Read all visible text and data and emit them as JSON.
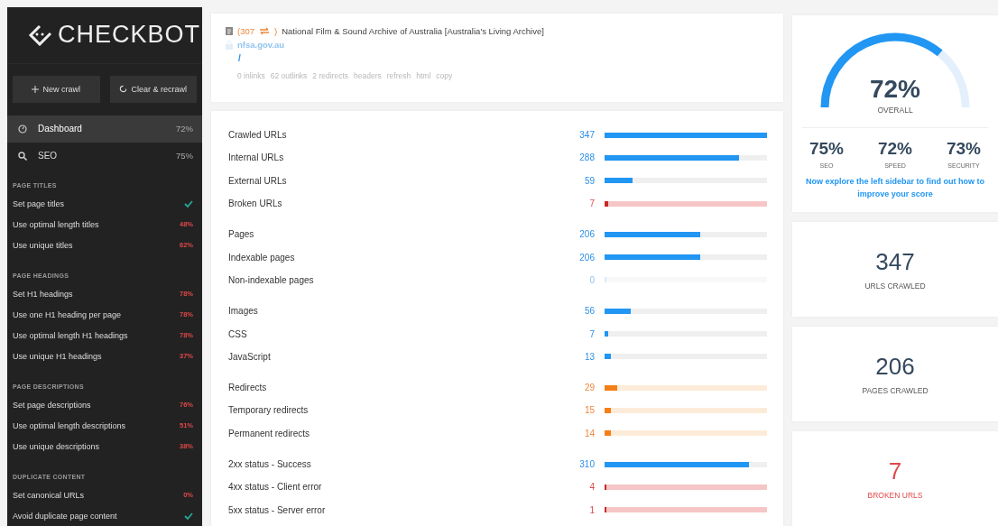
{
  "sidebar": {
    "logo": "CHECKBOT",
    "buttons": [
      {
        "kind": "new",
        "label": "New crawl"
      },
      {
        "kind": "recrawl",
        "label": "Clear & recrawl"
      }
    ],
    "nav": [
      {
        "kind": "dashboard",
        "label": "Dashboard",
        "value": "72%",
        "selected": true
      },
      {
        "kind": "search",
        "label": "SEO",
        "value": "75%",
        "selected": false
      }
    ],
    "sections": [
      {
        "title": "PAGE TITLES",
        "items": [
          {
            "label": "Set page titles",
            "kind": "check"
          },
          {
            "label": "Use optimal length titles",
            "kind": "percent",
            "value": "48%"
          },
          {
            "label": "Use unique titles",
            "kind": "percent",
            "value": "62%"
          }
        ]
      },
      {
        "title": "PAGE HEADINGS",
        "items": [
          {
            "label": "Set H1 headings",
            "kind": "percent",
            "value": "78%"
          },
          {
            "label": "Use one H1 heading per page",
            "kind": "percent",
            "value": "78%"
          },
          {
            "label": "Use optimal length H1 headings",
            "kind": "percent",
            "value": "78%"
          },
          {
            "label": "Use unique H1 headings",
            "kind": "percent",
            "value": "37%"
          }
        ]
      },
      {
        "title": "PAGE DESCRIPTIONS",
        "items": [
          {
            "label": "Set page descriptions",
            "kind": "percent",
            "value": "76%"
          },
          {
            "label": "Use optimal length descriptions",
            "kind": "percent",
            "value": "51%"
          },
          {
            "label": "Use unique descriptions",
            "kind": "percent",
            "value": "38%"
          }
        ]
      },
      {
        "title": "DUPLICATE CONTENT",
        "items": [
          {
            "label": "Set canonical URLs",
            "kind": "percent",
            "value": "0%"
          },
          {
            "label": "Avoid duplicate page content",
            "kind": "check"
          }
        ]
      }
    ]
  },
  "page_card": {
    "status_open": "(307",
    "status_close": ")",
    "title": "National Film & Sound Archive of Australia [Australia's Living Archive]",
    "domain": "nfsa.gov.au",
    "path": "/",
    "links": [
      "0 inlinks",
      "62 outlinks",
      "2 redirects",
      "headers",
      "refresh",
      "html",
      "copy"
    ]
  },
  "stats": [
    {
      "rows": [
        {
          "label": "Crawled URLs",
          "value": "347",
          "kind": "normal",
          "level": 1.0
        },
        {
          "label": "Internal URLs",
          "value": "288",
          "kind": "normal",
          "level": 0.83
        },
        {
          "label": "External URLs",
          "value": "59",
          "kind": "normal",
          "level": 0.17
        },
        {
          "label": "Broken URLs",
          "value": "7",
          "kind": "error",
          "level": 0.02
        }
      ]
    },
    {
      "rows": [
        {
          "label": "Pages",
          "value": "206",
          "kind": "normal",
          "level": 0.59
        },
        {
          "label": "Indexable pages",
          "value": "206",
          "kind": "normal",
          "level": 0.59
        },
        {
          "label": "Non-indexable pages",
          "value": "0",
          "kind": "empty",
          "level": 0
        }
      ]
    },
    {
      "rows": [
        {
          "label": "Images",
          "value": "56",
          "kind": "normal",
          "level": 0.16
        },
        {
          "label": "CSS",
          "value": "7",
          "kind": "normal",
          "level": 0.02
        },
        {
          "label": "JavaScript",
          "value": "13",
          "kind": "normal",
          "level": 0.04
        }
      ]
    },
    {
      "rows": [
        {
          "label": "Redirects",
          "value": "29",
          "kind": "warning",
          "level": 0.08
        },
        {
          "label": "Temporary redirects",
          "value": "15",
          "kind": "warning",
          "level": 0.04
        },
        {
          "label": "Permanent redirects",
          "value": "14",
          "kind": "warning",
          "level": 0.04
        }
      ]
    },
    {
      "rows": [
        {
          "label": "2xx status - Success",
          "value": "310",
          "kind": "normal",
          "level": 0.89
        },
        {
          "label": "4xx status - Client error",
          "value": "4",
          "kind": "error",
          "level": 0.012
        },
        {
          "label": "5xx status - Server error",
          "value": "1",
          "kind": "error",
          "level": 0.003
        }
      ]
    }
  ],
  "score": {
    "value": "72%",
    "label": "OVERALL",
    "parts": [
      {
        "value": "75%",
        "label": "SEO"
      },
      {
        "value": "72%",
        "label": "SPEED"
      },
      {
        "value": "73%",
        "label": "SECURITY"
      }
    ],
    "hint": "Now explore the left sidebar to find out how to improve your score"
  },
  "counters": [
    {
      "value": "347",
      "label": "URLS CRAWLED",
      "kind": "normal"
    },
    {
      "value": "206",
      "label": "PAGES CRAWLED",
      "kind": "normal"
    },
    {
      "value": "7",
      "label": "BROKEN URLS",
      "kind": "error"
    }
  ]
}
